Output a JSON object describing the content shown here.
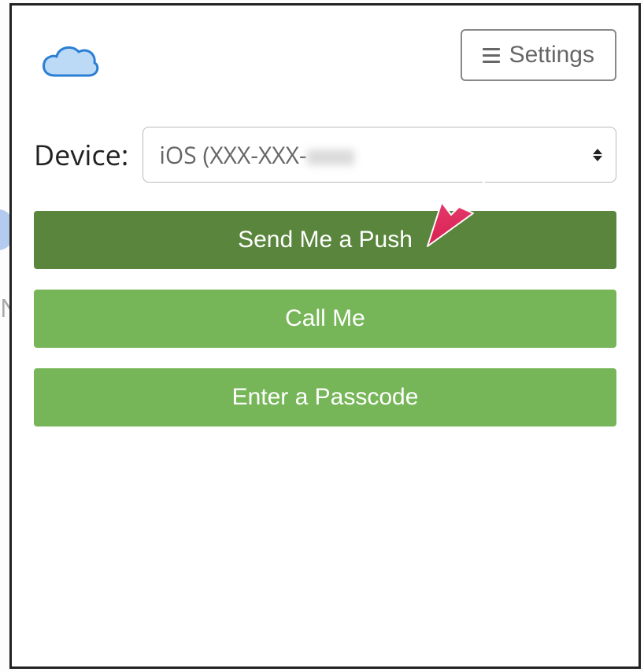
{
  "header": {
    "settings_label": "Settings"
  },
  "device": {
    "label": "Device:",
    "selected_prefix": "iOS (XXX-XXX-"
  },
  "actions": {
    "push_label": "Send Me a Push",
    "call_label": "Call Me",
    "passcode_label": "Enter a Passcode"
  },
  "colors": {
    "primary_dark": "#59853c",
    "primary_light": "#77b658",
    "annotation": "#e8376b"
  }
}
